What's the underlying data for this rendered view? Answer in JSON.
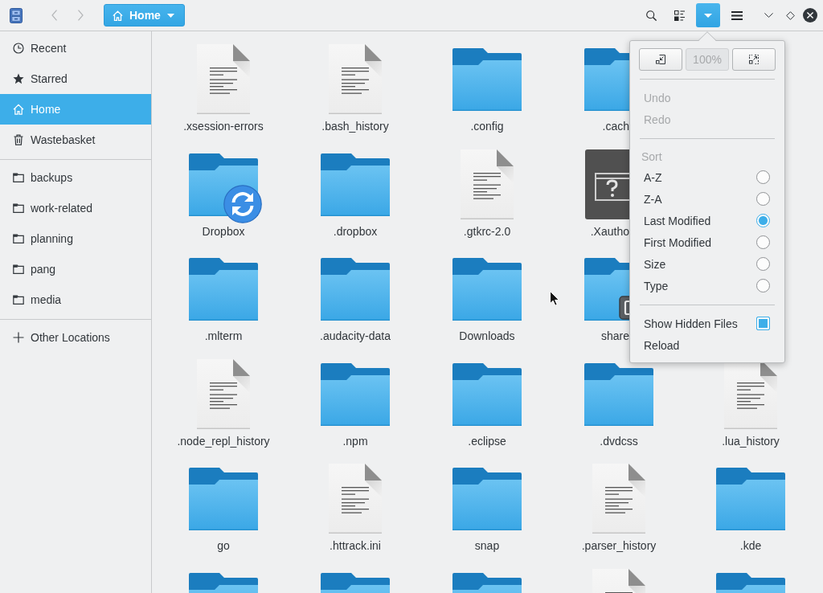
{
  "header": {
    "navigation": [
      {
        "kind": "back",
        "disabled": true
      },
      {
        "kind": "forward",
        "disabled": true
      }
    ],
    "location": {
      "kind": "home",
      "label": "Home"
    },
    "tools": [
      {
        "kind": "search",
        "selected": false
      },
      {
        "kind": "view",
        "selected": false
      },
      {
        "kind": "dropdown",
        "selected": true
      },
      {
        "kind": "menu",
        "selected": false
      }
    ],
    "window_controls": [
      {
        "kind": "minimize"
      },
      {
        "kind": "maximize"
      },
      {
        "kind": "close"
      }
    ]
  },
  "sidebar": {
    "sections": [
      {
        "items": [
          {
            "kind": "recent",
            "label": "Recent",
            "selected": false
          },
          {
            "kind": "starred",
            "label": "Starred",
            "selected": false
          },
          {
            "kind": "home",
            "label": "Home",
            "selected": true
          },
          {
            "kind": "trash",
            "label": "Wastebasket",
            "selected": false
          }
        ]
      },
      {
        "items": [
          {
            "kind": "folder",
            "label": "backups",
            "selected": false
          },
          {
            "kind": "folder",
            "label": "work-related",
            "selected": false
          },
          {
            "kind": "folder",
            "label": "planning",
            "selected": false
          },
          {
            "kind": "folder",
            "label": "pang",
            "selected": false
          },
          {
            "kind": "folder",
            "label": "media",
            "selected": false
          }
        ]
      },
      {
        "items": [
          {
            "kind": "other",
            "label": "Other Locations",
            "selected": false
          }
        ]
      }
    ]
  },
  "files": {
    "rows": [
      [
        {
          "kind": "text",
          "name": ".xsession-errors"
        },
        {
          "kind": "text",
          "name": ".bash_history"
        },
        {
          "kind": "folder",
          "name": ".config"
        },
        {
          "kind": "folder",
          "name": ".cach"
        }
      ],
      [
        {
          "kind": "folder",
          "name": "Dropbox",
          "emblem": {
            "kind": "sync"
          }
        },
        {
          "kind": "folder",
          "name": ".dropbox"
        },
        {
          "kind": "text",
          "name": ".gtkrc-2.0"
        },
        {
          "kind": "unknown",
          "name": ".Xautho"
        }
      ],
      [
        {
          "kind": "folder",
          "name": ".mlterm"
        },
        {
          "kind": "folder",
          "name": ".audacity-data"
        },
        {
          "kind": "folder",
          "name": "Downloads"
        },
        {
          "kind": "folder",
          "name": "share",
          "emblem": {
            "kind": "link"
          }
        }
      ],
      [
        {
          "kind": "text",
          "name": ".node_repl_history"
        },
        {
          "kind": "folder",
          "name": ".npm"
        },
        {
          "kind": "folder",
          "name": ".eclipse"
        },
        {
          "kind": "folder",
          "name": ".dvdcss"
        },
        {
          "kind": "text",
          "name": ".lua_history"
        }
      ],
      [
        {
          "kind": "folder",
          "name": "go"
        },
        {
          "kind": "text",
          "name": ".httrack.ini"
        },
        {
          "kind": "folder",
          "name": "snap"
        },
        {
          "kind": "text",
          "name": ".parser_history"
        },
        {
          "kind": "folder",
          "name": ".kde"
        }
      ],
      [
        {
          "kind": "folder"
        },
        {
          "kind": "folder"
        },
        {
          "kind": "folder"
        },
        {
          "kind": "text"
        },
        {
          "kind": "folder"
        }
      ]
    ]
  },
  "view_menu": {
    "zoom": [
      {
        "kind": "zoom-out",
        "disabled": false
      },
      {
        "kind": "reset",
        "label": "100%",
        "disabled": true
      },
      {
        "kind": "zoom-in",
        "disabled": false
      }
    ],
    "history": [
      {
        "label": "Undo",
        "disabled": true
      },
      {
        "label": "Redo",
        "disabled": true
      }
    ],
    "sort": {
      "heading": "Sort",
      "options": [
        {
          "label": "A-Z",
          "selected": false
        },
        {
          "label": "Z-A",
          "selected": false
        },
        {
          "label": "Last Modified",
          "selected": true
        },
        {
          "label": "First Modified",
          "selected": false
        },
        {
          "label": "Size",
          "selected": false
        },
        {
          "label": "Type",
          "selected": false
        }
      ]
    },
    "options": [
      {
        "kind": "checkbox",
        "label": "Show Hidden Files",
        "checked": true
      },
      {
        "kind": "action",
        "label": "Reload"
      }
    ]
  }
}
